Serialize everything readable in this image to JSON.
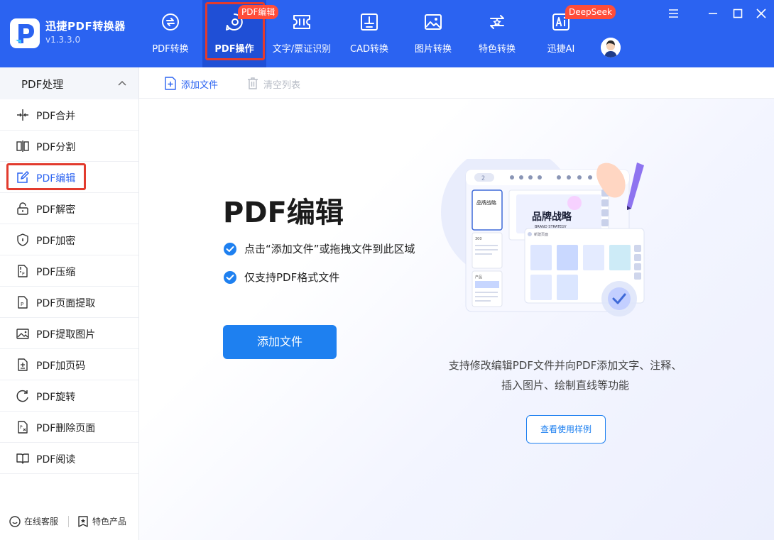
{
  "app": {
    "title": "迅捷PDF转换器",
    "version": "v1.3.3.0",
    "brand_color": "#2b63f1",
    "accent_red": "#e23b2e"
  },
  "nav": {
    "items": [
      {
        "label": "PDF转换",
        "icon": "pdf-convert-icon"
      },
      {
        "label": "PDF操作",
        "icon": "pdf-operate-icon",
        "active": true
      },
      {
        "label": "文字/票证识别",
        "icon": "ocr-icon"
      },
      {
        "label": "CAD转换",
        "icon": "cad-icon"
      },
      {
        "label": "图片转换",
        "icon": "image-icon"
      },
      {
        "label": "特色转换",
        "icon": "special-icon"
      },
      {
        "label": "迅捷AI",
        "icon": "ai-icon"
      }
    ],
    "badge_pdf": "PDF编辑",
    "badge_ai": "DeepSeek"
  },
  "sidebar": {
    "section": "PDF处理",
    "items": [
      {
        "label": "PDF合并",
        "icon": "merge-icon"
      },
      {
        "label": "PDF分割",
        "icon": "split-icon"
      },
      {
        "label": "PDF编辑",
        "icon": "edit-icon",
        "active": true
      },
      {
        "label": "PDF解密",
        "icon": "unlock-icon"
      },
      {
        "label": "PDF加密",
        "icon": "shield-icon"
      },
      {
        "label": "PDF压缩",
        "icon": "compress-icon"
      },
      {
        "label": "PDF页面提取",
        "icon": "page-extract-icon"
      },
      {
        "label": "PDF提取图片",
        "icon": "image-extract-icon"
      },
      {
        "label": "PDF加页码",
        "icon": "page-number-icon"
      },
      {
        "label": "PDF旋转",
        "icon": "rotate-icon"
      },
      {
        "label": "PDF删除页面",
        "icon": "delete-page-icon"
      },
      {
        "label": "PDF阅读",
        "icon": "book-icon"
      }
    ],
    "footer": {
      "service": "在线客服",
      "products": "特色产品"
    }
  },
  "toolbar": {
    "add_file": "添加文件",
    "clear_list": "清空列表"
  },
  "main": {
    "title": "PDF编辑",
    "tips": [
      "点击“添加文件”或拖拽文件到此区域",
      "仅支持PDF格式文件"
    ],
    "add_button": "添加文件",
    "description_line1": "支持修改编辑PDF文件并向PDF添加文字、注释、",
    "description_line2": "插入图片、绘制直线等功能",
    "example_button": "查看使用样例",
    "illustration": {
      "page_nav": "2",
      "doc_title": "品牌战略",
      "doc_subtitle": "BRAND STRATEGY",
      "thumb_title": "品牌战略",
      "thumb_page2": "300",
      "thumb_page3": "产品",
      "panel_title": "新建页面"
    }
  }
}
